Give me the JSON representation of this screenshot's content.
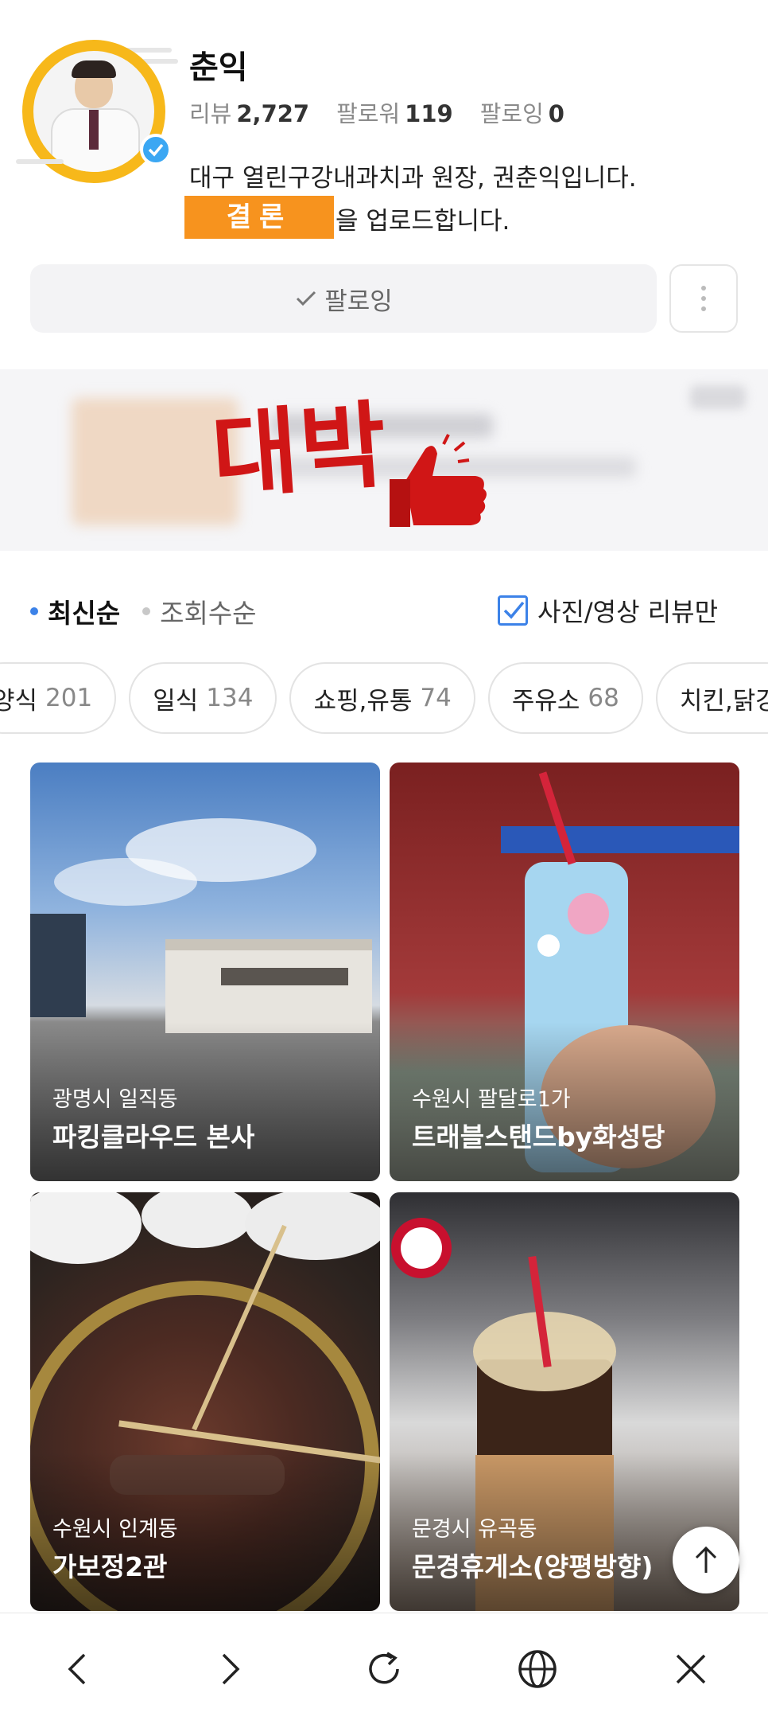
{
  "profile": {
    "name": "춘익",
    "stats": [
      {
        "label": "리뷰",
        "value": "2,727"
      },
      {
        "label": "팔로워",
        "value": "119"
      },
      {
        "label": "팔로잉",
        "value": "0"
      }
    ],
    "bio_line1": "대구 열린구강내과치과 원장, 권춘익입니다.",
    "bio_line2_suffix": "을 업로드합니다.",
    "redaction_label": "결론",
    "follow_button": "팔로잉",
    "more_icon": "more-vertical-icon",
    "verified": true,
    "accent": "#f7b81a"
  },
  "banner": {
    "overlay_text": "대박",
    "overlay_color": "#d01616"
  },
  "sort": {
    "active": "최신순",
    "inactive": "조회수순",
    "filter_label": "사진/영상 리뷰만",
    "filter_checked": true,
    "accent": "#3c82e8"
  },
  "categories": [
    {
      "label": "양식",
      "count": "201"
    },
    {
      "label": "일식",
      "count": "134"
    },
    {
      "label": "쇼핑,유통",
      "count": "74"
    },
    {
      "label": "주유소",
      "count": "68"
    },
    {
      "label": "치킨,닭강",
      "count": ""
    }
  ],
  "cards": [
    {
      "location": "광명시 일직동",
      "title": "파킹클라우드 본사"
    },
    {
      "location": "수원시 팔달로1가",
      "title": "트래블스탠드by화성당"
    },
    {
      "location": "수원시 인계동",
      "title": "가보정2관"
    },
    {
      "location": "문경시 유곡동",
      "title": "문경휴게소(양평방향)"
    }
  ],
  "nav": {
    "back_icon": "chevron-left-icon",
    "forward_icon": "chevron-right-icon",
    "refresh_icon": "refresh-icon",
    "globe_icon": "globe-icon",
    "close_icon": "close-icon"
  }
}
